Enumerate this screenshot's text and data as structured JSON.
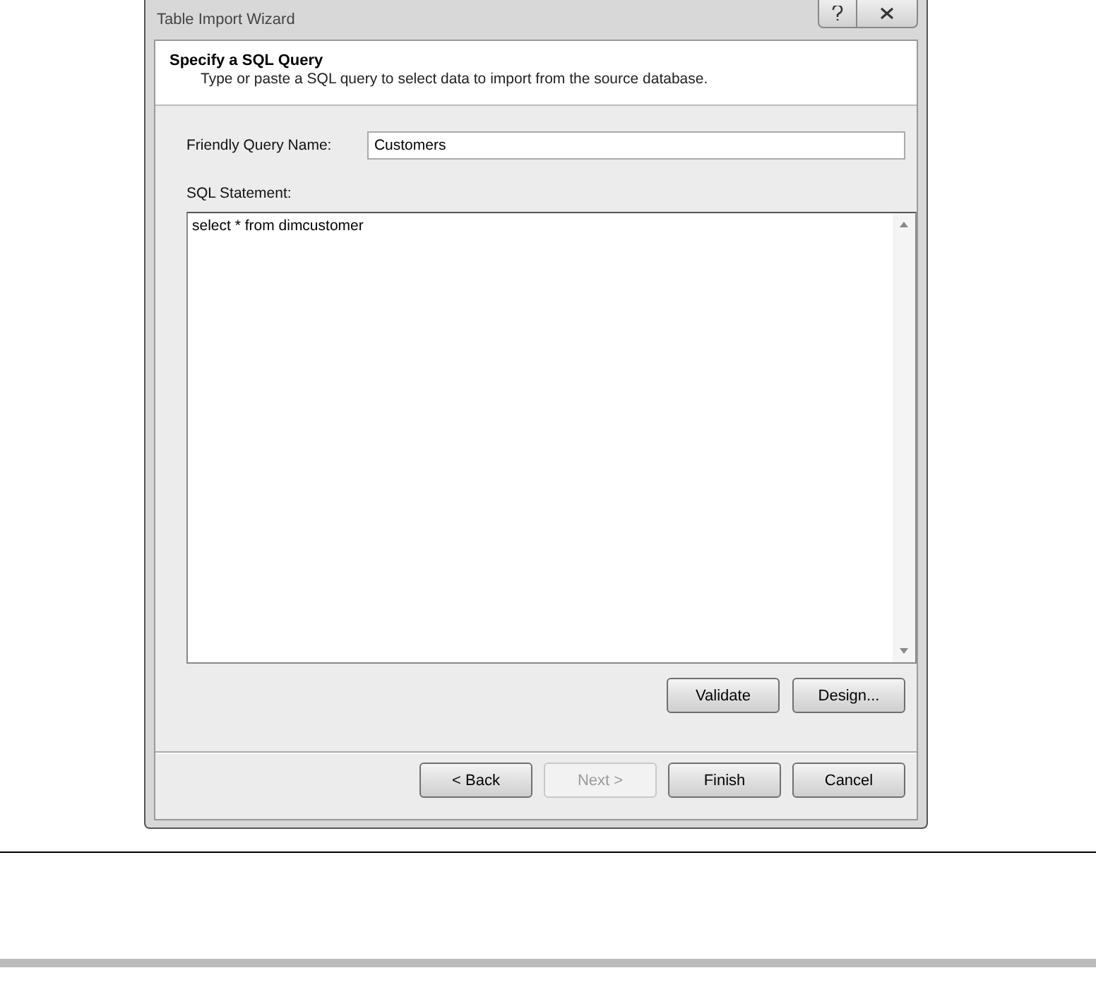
{
  "window": {
    "title": "Table Import Wizard"
  },
  "header": {
    "title": "Specify a SQL Query",
    "description": "Type or paste a SQL query to select data to import from the source database."
  },
  "friendly_query_name": {
    "label": "Friendly Query Name:",
    "value": "Customers"
  },
  "sql_statement": {
    "label": "SQL Statement:",
    "value": "select * from dimcustomer"
  },
  "query_buttons": [
    {
      "label": "Validate",
      "disabled": false
    },
    {
      "label": "Design...",
      "disabled": false
    }
  ],
  "nav_buttons": [
    {
      "label": "< Back",
      "disabled": false
    },
    {
      "label": "Next >",
      "disabled": true
    },
    {
      "label": "Finish",
      "disabled": false
    },
    {
      "label": "Cancel",
      "disabled": false
    }
  ]
}
